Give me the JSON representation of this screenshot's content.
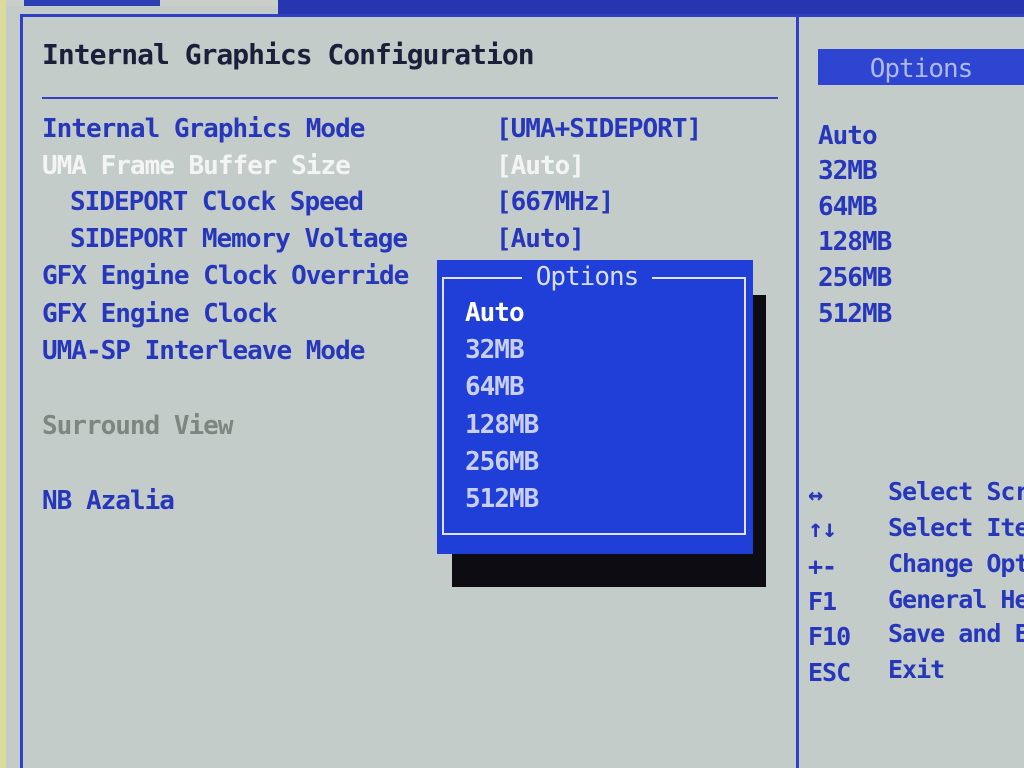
{
  "screen": {
    "title": "Internal Graphics Configuration",
    "settings": [
      {
        "label": "Internal Graphics Mode",
        "value": "[UMA+SIDEPORT]"
      },
      {
        "label": "UMA Frame Buffer Size",
        "value": "[Auto]"
      },
      {
        "label": "SIDEPORT Clock Speed",
        "value": "[667MHz]"
      },
      {
        "label": "SIDEPORT Memory Voltage",
        "value": "[Auto]"
      },
      {
        "label": "GFX Engine Clock Override",
        "value": ""
      },
      {
        "label": "GFX Engine Clock",
        "value": ""
      },
      {
        "label": "UMA-SP Interleave Mode",
        "value": ""
      },
      {
        "label": "Surround View",
        "value": ""
      },
      {
        "label": "NB Azalia",
        "value": ""
      }
    ]
  },
  "popup": {
    "title": "Options",
    "options": [
      "Auto",
      "32MB",
      "64MB",
      "128MB",
      "256MB",
      "512MB"
    ],
    "selected": "Auto"
  },
  "help_panel": {
    "title": "Options",
    "items": [
      "Auto",
      "32MB",
      "64MB",
      "128MB",
      "256MB",
      "512MB"
    ],
    "keys": [
      {
        "key": "↔",
        "desc": "Select Scr"
      },
      {
        "key": "↑↓",
        "desc": "Select Ite"
      },
      {
        "key": "+-",
        "desc": "Change Opt"
      },
      {
        "key": "F1",
        "desc": "General He"
      },
      {
        "key": "F10",
        "desc": "Save and E"
      },
      {
        "key": "ESC",
        "desc": "Exit"
      }
    ]
  },
  "colors": {
    "background": "#c4ccc9",
    "text_blue": "#2637bc",
    "highlight": "#f3f5f5",
    "disabled": "#7d8780",
    "popup_blue": "#1f3fd8"
  }
}
